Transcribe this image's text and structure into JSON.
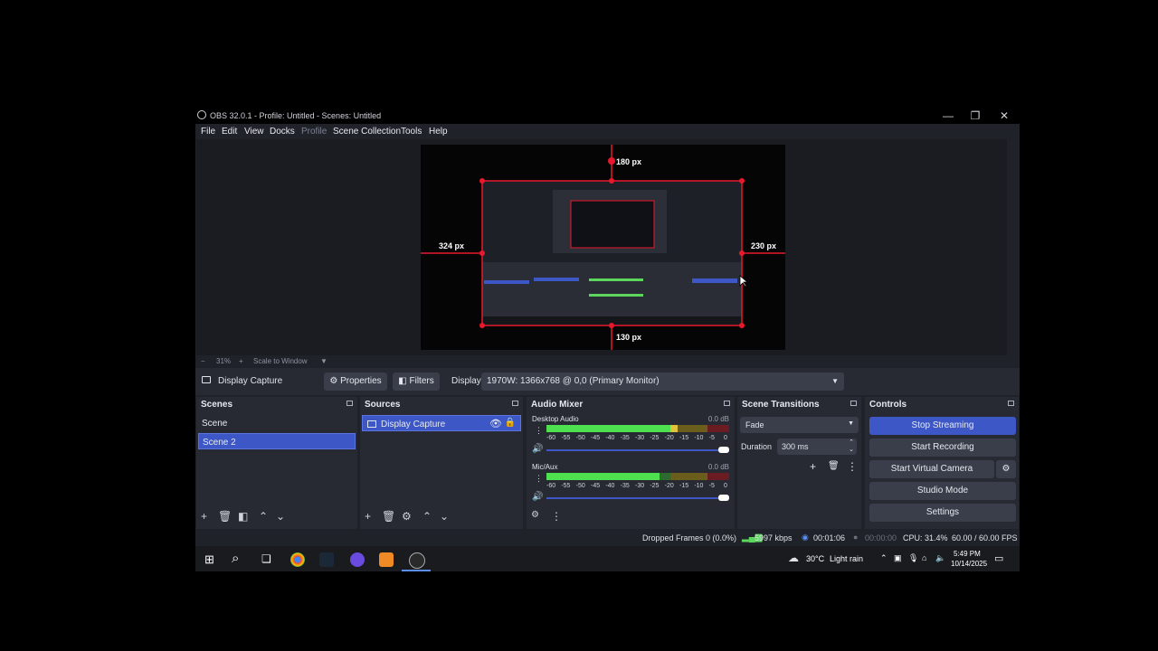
{
  "window": {
    "title": "OBS 32.0.1 - Profile: Untitled - Scenes: Untitled",
    "minimize": "—",
    "maximize": "❐",
    "close": "✕"
  },
  "menu": [
    "File",
    "Edit",
    "View",
    "Docks",
    "Profile",
    "Scene Collection",
    "Tools",
    "Help"
  ],
  "preview": {
    "margin_top": "180 px",
    "margin_left": "324 px",
    "margin_right": "230 px",
    "margin_bottom": "130 px"
  },
  "zoom": {
    "minus": "−",
    "value": "31%",
    "plus": "+",
    "mode": "Scale to Window"
  },
  "source_toolbar": {
    "source_name": "Display Capture",
    "properties": "Properties",
    "filters": "Filters",
    "display_label": "Display",
    "display_value": "1970W: 1366x768 @ 0,0 (Primary Monitor)"
  },
  "scenes": {
    "title": "Scenes",
    "items": [
      "Scene",
      "Scene 2"
    ],
    "selected": 1
  },
  "sources": {
    "title": "Sources",
    "items": [
      "Display Capture"
    ]
  },
  "mixer": {
    "title": "Audio Mixer",
    "channels": [
      {
        "name": "Desktop Audio",
        "db": "0.0 dB",
        "level": 0.72
      },
      {
        "name": "Mic/Aux",
        "db": "0.0 dB",
        "level": 0.62
      }
    ],
    "scale": [
      "-60",
      "-55",
      "-50",
      "-45",
      "-40",
      "-35",
      "-30",
      "-25",
      "-20",
      "-15",
      "-10",
      "-5",
      "0"
    ]
  },
  "transitions": {
    "title": "Scene Transitions",
    "type": "Fade",
    "duration_label": "Duration",
    "duration_value": "300 ms"
  },
  "controls": {
    "title": "Controls",
    "stop_streaming": "Stop Streaming",
    "start_recording": "Start Recording",
    "start_virtual_camera": "Start Virtual Camera",
    "studio_mode": "Studio Mode",
    "settings": "Settings"
  },
  "status": {
    "dropped_frames": "Dropped Frames 0 (0.0%)",
    "bitrate": "5997 kbps",
    "stream_time": "00:01:06",
    "rec_time": "00:00:00",
    "cpu": "CPU: 31.4%",
    "fps": "60.00 / 60.00 FPS"
  },
  "taskbar": {
    "weather_temp": "30°C",
    "weather_desc": "Light rain",
    "time": "5:49 PM",
    "date": "10/14/2025"
  },
  "colors": {
    "accent": "#3d57c6",
    "window_bg": "#202229",
    "dock_bg": "#272a33",
    "crop_red": "#e8192c"
  }
}
